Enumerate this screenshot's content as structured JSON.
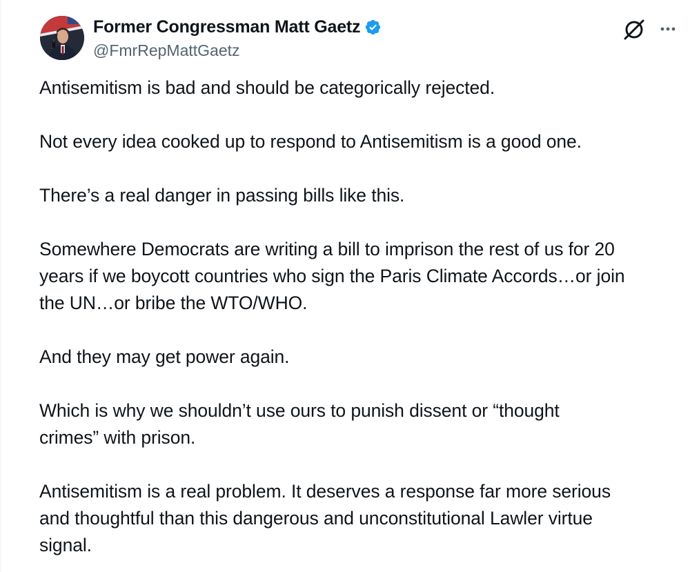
{
  "author": {
    "display_name": "Former Congressman Matt Gaetz",
    "handle": "@FmrRepMattGaetz",
    "verified": true,
    "verified_badge_color": "#1d9bf0",
    "avatar_icon": "profile-photo"
  },
  "actions": {
    "grok_icon": "grok-slash-circle-icon",
    "more_icon": "more-horizontal-icon"
  },
  "post": {
    "paragraphs": [
      "Antisemitism is bad and should be categorically rejected.",
      "Not every idea cooked up to respond to Antisemitism is a good one.",
      "There’s a real danger in passing bills like this.",
      "Somewhere Democrats are writing a bill to imprison the rest of us for 20\nyears if we boycott countries who sign the Paris Climate Accords…or join\nthe UN…or bribe the WTO/WHO.",
      "And they may get power again.",
      "Which is why we shouldn’t use ours to punish dissent or “thought\ncrimes” with prison.",
      "Antisemitism is a real problem.  It deserves a response far more serious\nand thoughtful than this dangerous and unconstitutional Lawler virtue\nsignal."
    ]
  },
  "colors": {
    "text_primary": "#0f1419",
    "text_secondary": "#536471",
    "background": "#ffffff"
  }
}
